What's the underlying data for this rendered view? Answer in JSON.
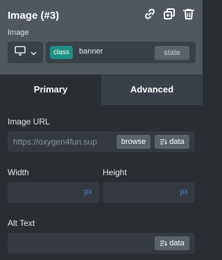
{
  "header": {
    "title": "Image (#3)",
    "icons": [
      "link-icon",
      "duplicate-icon",
      "trash-icon"
    ],
    "label": "Image",
    "device_icon": "desktop-icon"
  },
  "selector": {
    "badge": "class",
    "value": "banner",
    "state_label": "state"
  },
  "tabs": {
    "primary": "Primary",
    "advanced": "Advanced"
  },
  "fields": {
    "image_url": {
      "label": "Image URL",
      "value": "https://oxygen4fun.sup",
      "browse_label": "browse",
      "data_label": "data"
    },
    "width": {
      "label": "Width",
      "unit": "px"
    },
    "height": {
      "label": "Height",
      "unit": "px"
    },
    "alt_text": {
      "label": "Alt Text",
      "data_label": "data"
    }
  },
  "colors": {
    "header_bg": "#50575f",
    "panel_bg": "#2a2e33",
    "badge": "#1e8f86",
    "unit": "#4e7fbf"
  }
}
